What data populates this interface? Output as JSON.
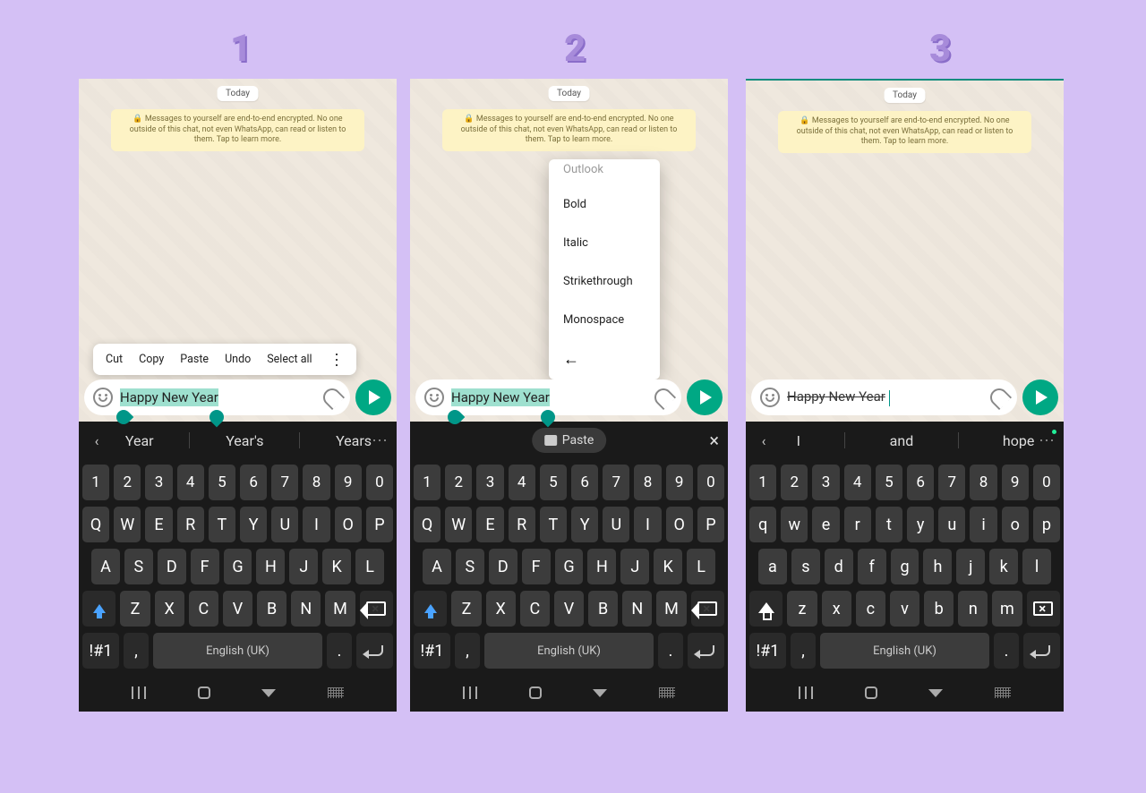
{
  "steps": [
    "1",
    "2",
    "3"
  ],
  "chat": {
    "today": "Today",
    "encryption": "🔒 Messages to yourself are end-to-end encrypted. No one outside of this chat, not even WhatsApp, can read or listen to them. Tap to learn more."
  },
  "input": {
    "text1": "Happy New Year",
    "text2": "Happy New Year",
    "text3_strike": "Happy",
    "text3_rest": " New Year"
  },
  "context_toolbar": {
    "cut": "Cut",
    "copy": "Copy",
    "paste": "Paste",
    "undo": "Undo",
    "select_all": "Select all"
  },
  "format_menu": {
    "top_cut": "Outlook",
    "bold": "Bold",
    "italic": "Italic",
    "strike": "Strikethrough",
    "mono": "Monospace",
    "back": "←"
  },
  "suggestions1": [
    "Year",
    "Year's",
    "Years"
  ],
  "paste_chip": "Paste",
  "suggestions3": [
    "I",
    "and",
    "hope"
  ],
  "keyboard": {
    "row_num": [
      "1",
      "2",
      "3",
      "4",
      "5",
      "6",
      "7",
      "8",
      "9",
      "0"
    ],
    "row_q_upper": [
      "Q",
      "W",
      "E",
      "R",
      "T",
      "Y",
      "U",
      "I",
      "O",
      "P"
    ],
    "row_a_upper": [
      "A",
      "S",
      "D",
      "F",
      "G",
      "H",
      "J",
      "K",
      "L"
    ],
    "row_z_upper": [
      "Z",
      "X",
      "C",
      "V",
      "B",
      "N",
      "M"
    ],
    "row_q_lower": [
      "q",
      "w",
      "e",
      "r",
      "t",
      "y",
      "u",
      "i",
      "o",
      "p"
    ],
    "row_a_lower": [
      "a",
      "s",
      "d",
      "f",
      "g",
      "h",
      "j",
      "k",
      "l"
    ],
    "row_z_lower": [
      "z",
      "x",
      "c",
      "v",
      "b",
      "n",
      "m"
    ],
    "sym": "!#1",
    "comma": ",",
    "space": "English (UK)",
    "period": "."
  }
}
